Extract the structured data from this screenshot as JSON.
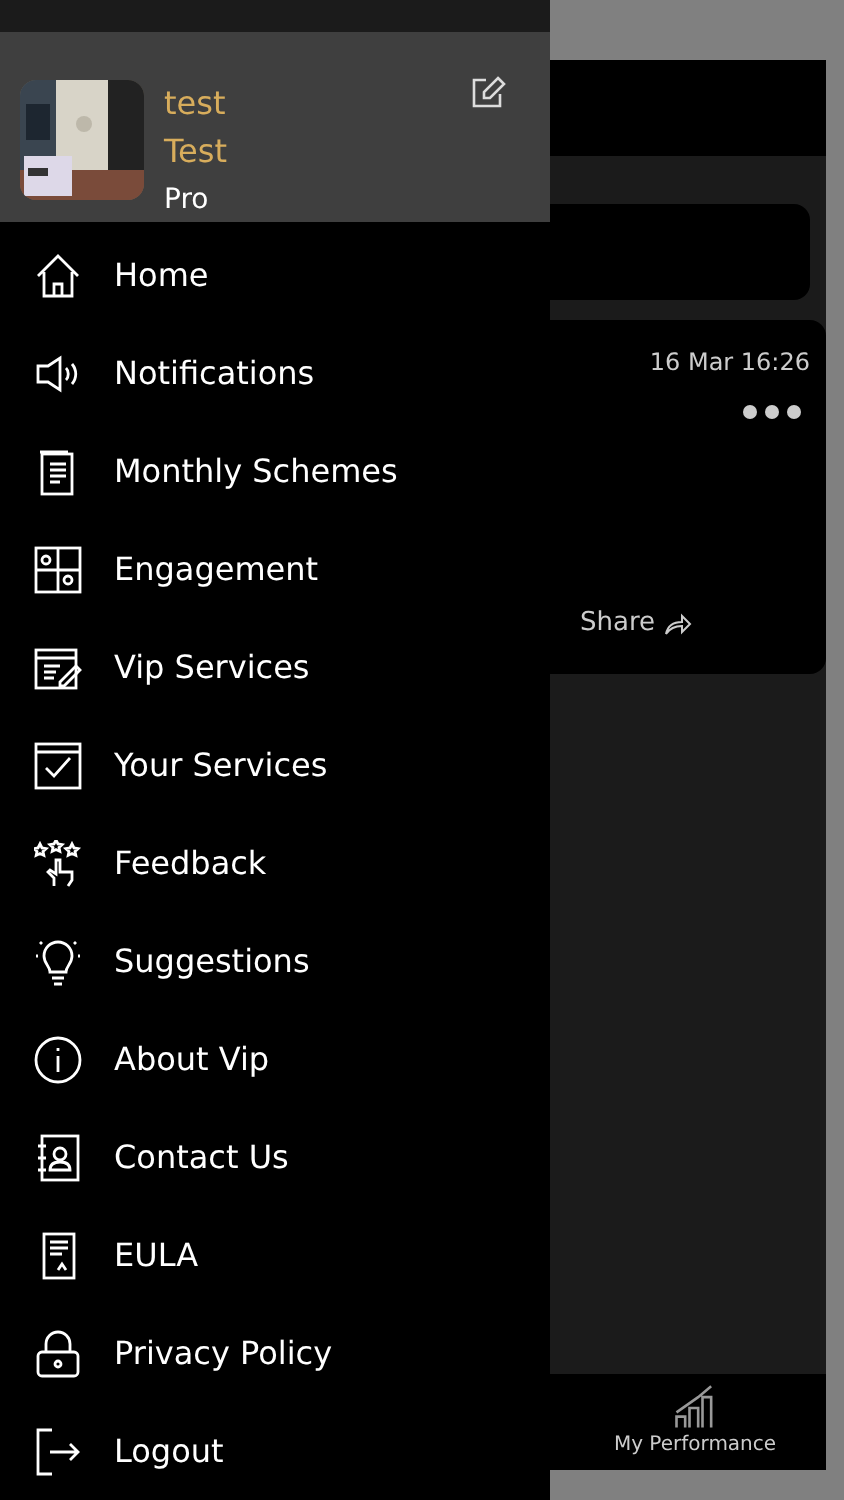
{
  "profile": {
    "username": "test",
    "display_name": "Test",
    "tier": "Pro"
  },
  "menu": [
    {
      "label": "Home"
    },
    {
      "label": "Notifications"
    },
    {
      "label": "Monthly Schemes"
    },
    {
      "label": "Engagement"
    },
    {
      "label": "Vip Services"
    },
    {
      "label": "Your Services"
    },
    {
      "label": "Feedback"
    },
    {
      "label": "Suggestions"
    },
    {
      "label": "About Vip"
    },
    {
      "label": "Contact Us"
    },
    {
      "label": "EULA"
    },
    {
      "label": "Privacy Policy"
    },
    {
      "label": "Logout"
    }
  ],
  "feed": {
    "post": {
      "time": "16 Mar 16:26",
      "share": "Share"
    }
  },
  "tab_bar": {
    "tab": {
      "label": "My Performance"
    }
  }
}
